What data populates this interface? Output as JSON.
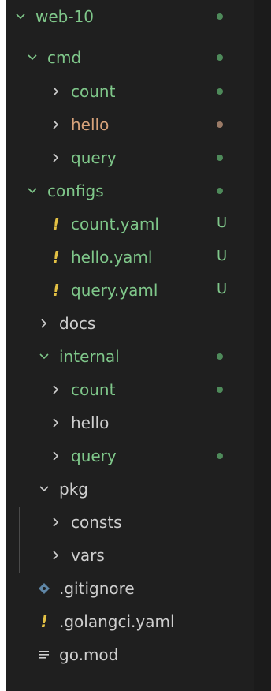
{
  "colors": {
    "green": "#7fc78a",
    "orange": "#d7a27a",
    "white": "#cfcfcf",
    "dot_green": "#4e8a5a",
    "dot_orange": "#9a7a66",
    "yellow_excl": "#e2c044",
    "git_icon": "#5f86a6"
  },
  "tree": {
    "rows": [
      {
        "label": "web-10",
        "status": "dot"
      },
      {
        "label": "cmd",
        "status": "dot"
      },
      {
        "label": "count",
        "status": "dot"
      },
      {
        "label": "hello",
        "status": "dot"
      },
      {
        "label": "query",
        "status": "dot"
      },
      {
        "label": "configs",
        "status": "dot"
      },
      {
        "label": "count.yaml",
        "badge": "U"
      },
      {
        "label": "hello.yaml",
        "badge": "U"
      },
      {
        "label": "query.yaml",
        "badge": "U"
      },
      {
        "label": "docs"
      },
      {
        "label": "internal",
        "status": "dot"
      },
      {
        "label": "count",
        "status": "dot"
      },
      {
        "label": "hello"
      },
      {
        "label": "query",
        "status": "dot"
      },
      {
        "label": "pkg"
      },
      {
        "label": "consts"
      },
      {
        "label": "vars"
      },
      {
        "label": ".gitignore"
      },
      {
        "label": ".golangci.yaml"
      },
      {
        "label": "go.mod"
      }
    ]
  },
  "icons": {
    "chevron_down": "chevron-down-icon",
    "chevron_right": "chevron-right-icon",
    "yaml": "yaml-exclamation-icon",
    "git": "git-diamond-icon",
    "gomod": "menu-lines-icon"
  }
}
